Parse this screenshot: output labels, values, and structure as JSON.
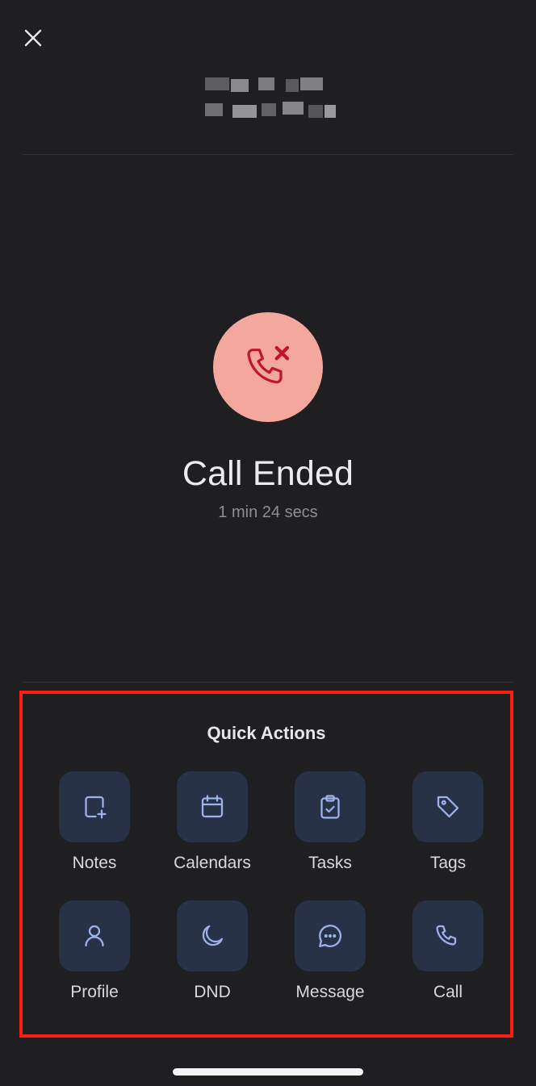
{
  "header": {
    "close_icon": "close-icon"
  },
  "call_status": {
    "icon": "phone-missed-icon",
    "title": "Call Ended",
    "duration": "1 min 24 secs",
    "circle_color": "#f4a79c",
    "icon_color": "#c0162a"
  },
  "quick_actions": {
    "title": "Quick Actions",
    "items": [
      {
        "label": "Notes",
        "icon": "note-add-icon"
      },
      {
        "label": "Calendars",
        "icon": "calendar-icon"
      },
      {
        "label": "Tasks",
        "icon": "clipboard-check-icon"
      },
      {
        "label": "Tags",
        "icon": "tag-icon"
      },
      {
        "label": "Profile",
        "icon": "user-icon"
      },
      {
        "label": "DND",
        "icon": "moon-icon"
      },
      {
        "label": "Message",
        "icon": "chat-bubble-icon"
      },
      {
        "label": "Call",
        "icon": "phone-icon"
      }
    ],
    "tile_color": "#283247",
    "icon_color": "#9db3ea",
    "highlight_color": "#ff1e12"
  }
}
